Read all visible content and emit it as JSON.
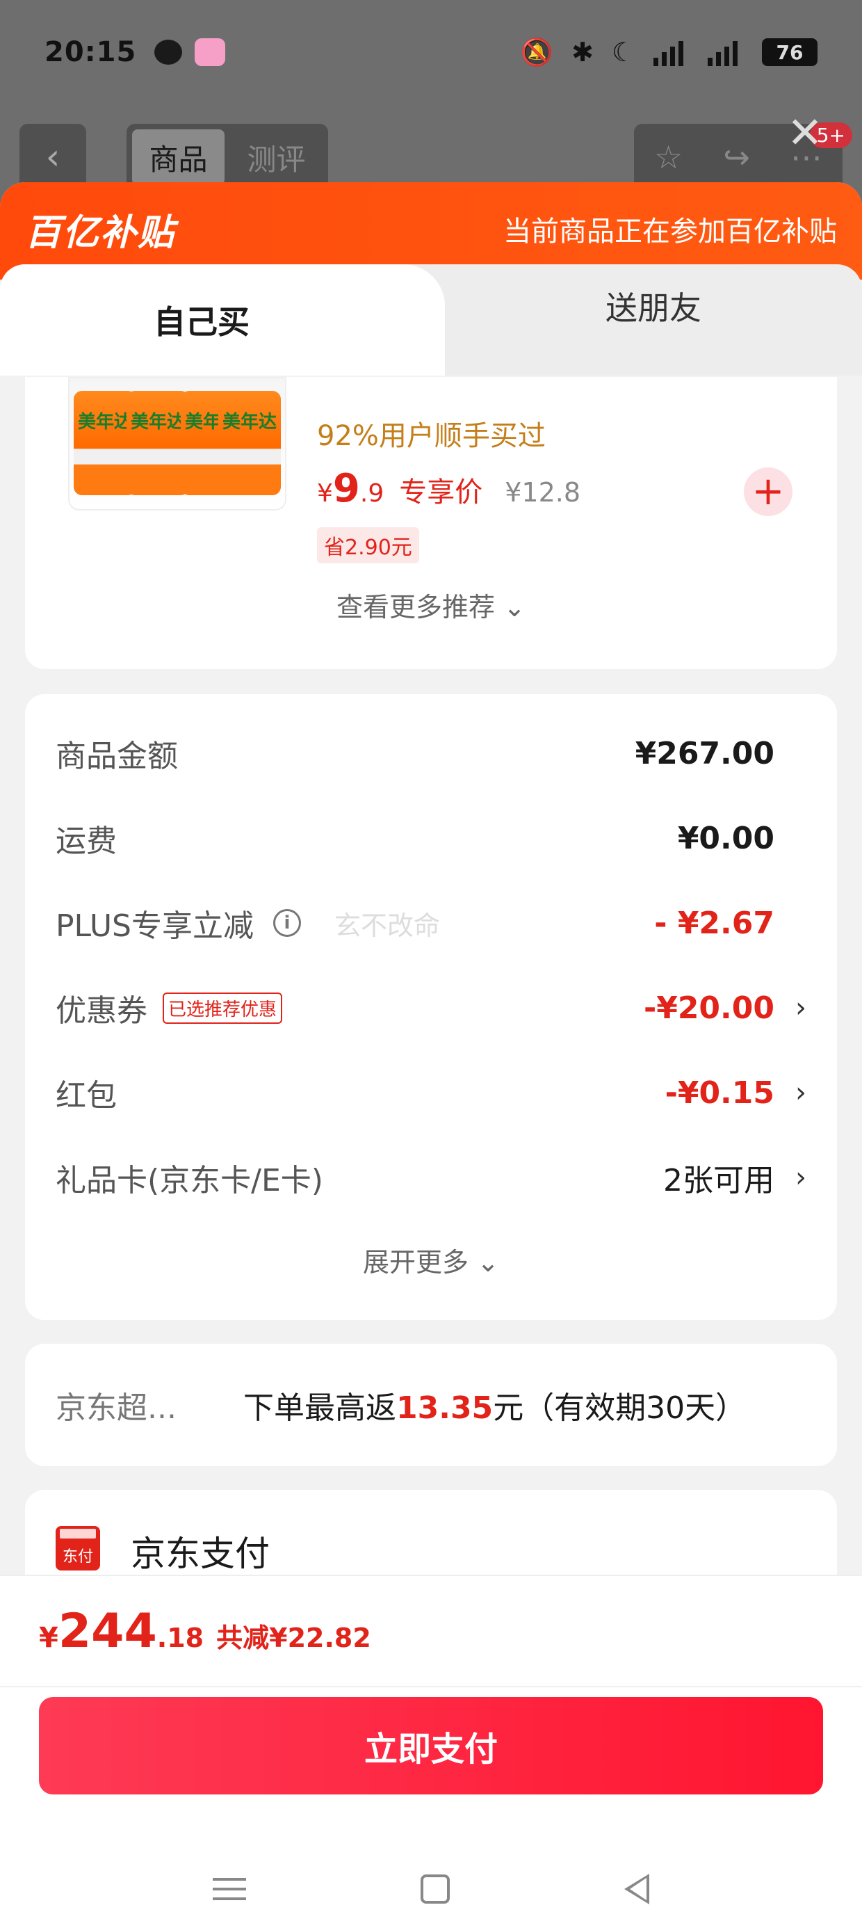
{
  "status_bar": {
    "time": "20:15",
    "signal_1": "5G",
    "signal_2": "5G",
    "battery": "76"
  },
  "background_page": {
    "back_icon": "chevron-left-icon",
    "tabs": [
      "商品",
      "测评"
    ],
    "active_tab": "商品",
    "badge": "5+"
  },
  "banner": {
    "logo": "百亿补贴",
    "message": "当前商品正在参加百亿补贴"
  },
  "segment": {
    "buy_self": "自己买",
    "gift_friend": "送朋友"
  },
  "recommendation": {
    "sold_text": "92%用户顺手买过",
    "price_yen": "¥",
    "price_int": "9",
    "price_dec": ".9",
    "price_tag": "专享价",
    "original_price": "¥12.8",
    "save_text": "省2.90元",
    "can_label": "美年达",
    "more_label": "查看更多推荐 ⌄"
  },
  "fees": {
    "goods_amount_label": "商品金额",
    "goods_amount_value": "¥267.00",
    "shipping_label": "运费",
    "shipping_value": "¥0.00",
    "plus_label": "PLUS专享立减",
    "plus_value": "- ¥2.67",
    "watermark": "玄不改命",
    "coupon_label": "优惠券",
    "coupon_tag": "已选推荐优惠",
    "coupon_value": "-¥20.00",
    "redpacket_label": "红包",
    "redpacket_value": "-¥0.15",
    "giftcard_label": "礼品卡(京东卡/E卡)",
    "giftcard_value": "2张可用",
    "expand_label": "展开更多 ⌄"
  },
  "rebate": {
    "label": "京东超...",
    "text_before": "下单最高返",
    "amount": "13.35",
    "text_after": "元（有效期30天）"
  },
  "payment": {
    "icon_text": "东付",
    "label": "京东支付"
  },
  "footer": {
    "total_yen": "¥",
    "total_int": "244",
    "total_dec": ".18",
    "discount": "共减¥22.82",
    "pay_button": "立即支付"
  },
  "colors": {
    "brand_orange": "#ff4a0c",
    "price_red": "#e2231a",
    "pay_button": "#ff1530"
  }
}
